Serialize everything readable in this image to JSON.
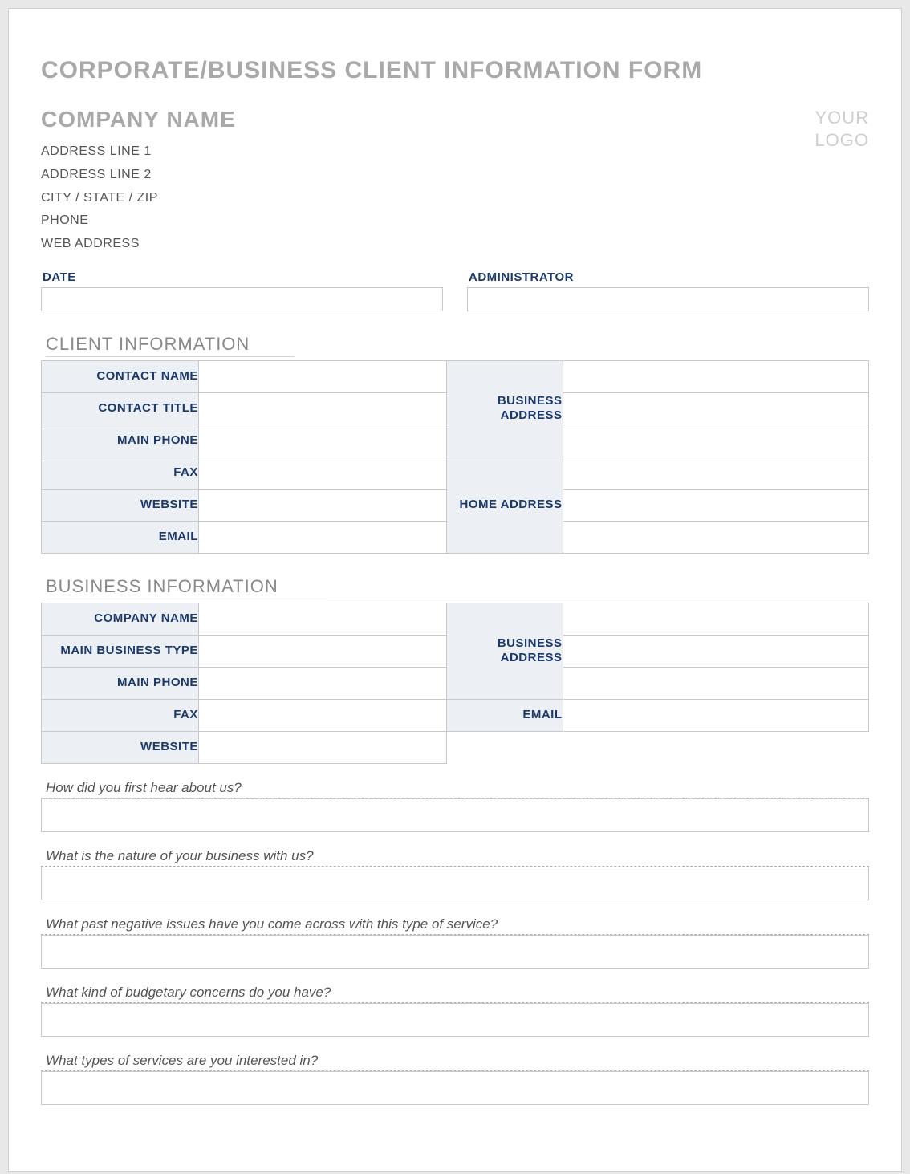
{
  "header": {
    "form_title": "CORPORATE/BUSINESS CLIENT INFORMATION FORM",
    "company_name": "COMPANY NAME",
    "address_lines": [
      "ADDRESS LINE 1",
      "ADDRESS LINE 2",
      "CITY / STATE / ZIP",
      "PHONE",
      "WEB ADDRESS"
    ],
    "logo_line1": "YOUR",
    "logo_line2": "LOGO"
  },
  "date_admin": {
    "date_label": "DATE",
    "date_value": "",
    "admin_label": "ADMINISTRATOR",
    "admin_value": ""
  },
  "client_info": {
    "section_title": "CLIENT INFORMATION",
    "contact_name_label": "CONTACT NAME",
    "contact_title_label": "CONTACT TITLE",
    "main_phone_label": "MAIN PHONE",
    "fax_label": "FAX",
    "website_label": "WEBSITE",
    "email_label": "EMAIL",
    "business_address_label": "BUSINESS ADDRESS",
    "home_address_label": "HOME ADDRESS"
  },
  "business_info": {
    "section_title": "BUSINESS INFORMATION",
    "company_name_label": "COMPANY NAME",
    "main_business_type_label": "MAIN BUSINESS TYPE",
    "main_phone_label": "MAIN PHONE",
    "fax_label": "FAX",
    "website_label": "WEBSITE",
    "business_address_label": "BUSINESS ADDRESS",
    "email_label": "EMAIL"
  },
  "questions": {
    "q1": "How did you first hear about us?",
    "q2": "What is the nature of your business with us?",
    "q3": "What past negative issues have you come across with this type of service?",
    "q4": "What kind of budgetary concerns do you have?",
    "q5": "What types of services are you interested in?"
  }
}
